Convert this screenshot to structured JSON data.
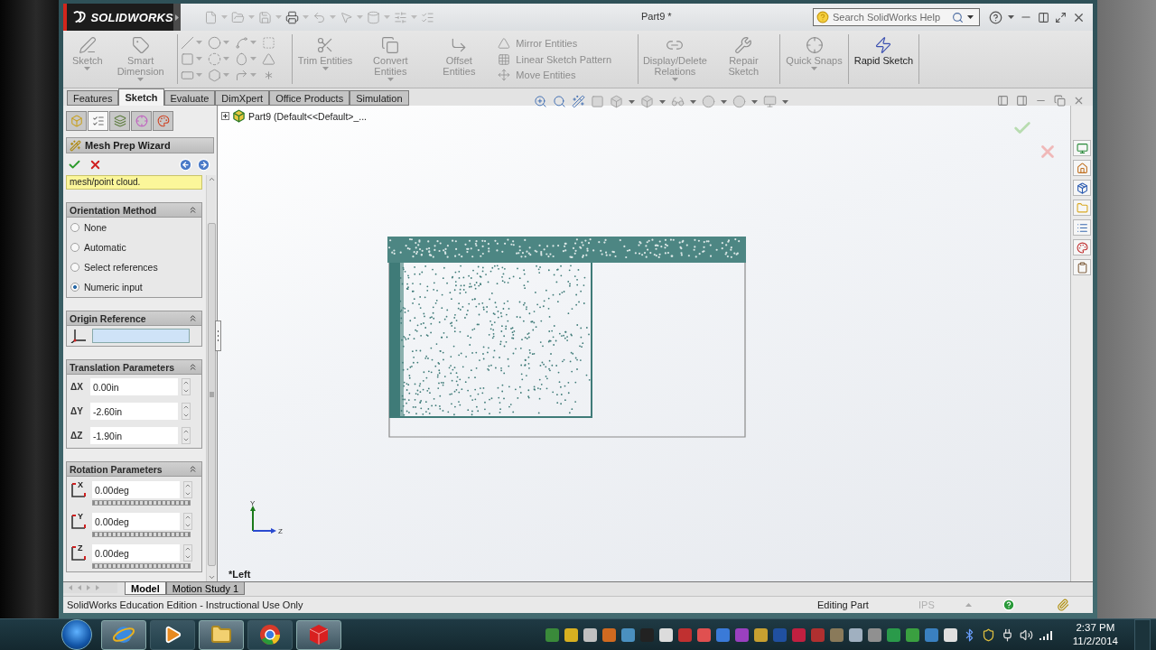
{
  "window": {
    "brand": "SOLIDWORKS",
    "title": "Part9 *"
  },
  "help_search": {
    "placeholder": "Search SolidWorks Help"
  },
  "ribbon": [
    [
      {
        "kind": "large",
        "label": "Sketch",
        "disabled": true,
        "menu": true
      },
      {
        "kind": "large",
        "label": "Smart Dimension",
        "disabled": true,
        "menu": true
      }
    ],
    [
      {
        "kind": "tools"
      }
    ],
    [
      {
        "kind": "large",
        "label": "Trim Entities",
        "disabled": true,
        "menu": true
      },
      {
        "kind": "large",
        "label": "Convert Entities",
        "disabled": true,
        "menu": true
      },
      {
        "kind": "large",
        "label": "Offset Entities",
        "disabled": true,
        "menu": false
      },
      {
        "kind": "list",
        "entries": [
          {
            "label": "Mirror Entities",
            "disabled": true
          },
          {
            "label": "Linear Sketch Pattern",
            "disabled": true
          },
          {
            "label": "Move Entities",
            "disabled": true
          }
        ]
      }
    ],
    [
      {
        "kind": "large",
        "label": "Display/Delete Relations",
        "disabled": true,
        "menu": true
      },
      {
        "kind": "large",
        "label": "Repair Sketch",
        "disabled": true,
        "menu": false
      }
    ],
    [
      {
        "kind": "large",
        "label": "Quick Snaps",
        "disabled": true,
        "menu": true
      }
    ],
    [
      {
        "kind": "large",
        "label": "Rapid Sketch",
        "disabled": false,
        "menu": false
      }
    ]
  ],
  "command_tabs": [
    {
      "label": "Features",
      "selected": false
    },
    {
      "label": "Sketch",
      "selected": true
    },
    {
      "label": "Evaluate",
      "selected": false
    },
    {
      "label": "DimXpert",
      "selected": false
    },
    {
      "label": "Office Products",
      "selected": false
    },
    {
      "label": "Simulation",
      "selected": false
    }
  ],
  "feature_tree": {
    "root": "Part9  (Default<<Default>_...",
    "expanded": false
  },
  "property_manager": {
    "panel_tabs": [
      {
        "selected": false
      },
      {
        "selected": true
      },
      {
        "selected": false
      },
      {
        "selected": false
      },
      {
        "selected": false
      }
    ],
    "title": "Mesh Prep Wizard",
    "message": "mesh/point cloud.",
    "sections": [
      {
        "kind": "radios",
        "title": "Orientation Method",
        "options": [
          {
            "label": "None",
            "selected": false
          },
          {
            "label": "Automatic",
            "selected": false
          },
          {
            "label": "Select references",
            "selected": false
          },
          {
            "label": "Numeric input",
            "selected": true
          }
        ]
      },
      {
        "kind": "reference",
        "title": "Origin Reference"
      },
      {
        "kind": "spinners",
        "title": "Translation Parameters",
        "fields": [
          {
            "label": "ΔX",
            "value": "0.00in"
          },
          {
            "label": "ΔY",
            "value": "-2.60in"
          },
          {
            "label": "ΔZ",
            "value": "-1.90in"
          }
        ]
      },
      {
        "kind": "rotations",
        "title": "Rotation Parameters",
        "fields": [
          {
            "axis": "X",
            "value": "0.00deg"
          },
          {
            "axis": "Y",
            "value": "0.00deg"
          },
          {
            "axis": "Z",
            "value": "0.00deg"
          }
        ]
      }
    ]
  },
  "view": {
    "orientation": "*Left",
    "triad": {
      "y": "Y",
      "z": "Z"
    }
  },
  "bottom_tabs": [
    {
      "label": "Model",
      "selected": true
    },
    {
      "label": "Motion Study 1",
      "selected": false
    }
  ],
  "status_bar": {
    "message": "SolidWorks Education Edition - Instructional Use Only",
    "mode": "Editing Part",
    "units": "IPS"
  },
  "taskbar": {
    "time": "2:37 PM",
    "date": "11/2/2014"
  }
}
